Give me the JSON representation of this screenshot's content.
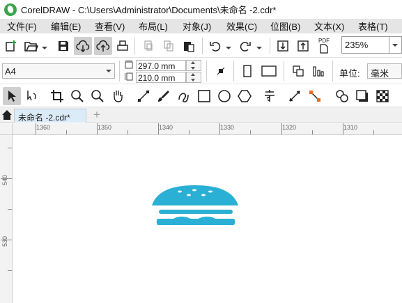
{
  "window": {
    "title": "CorelDRAW - C:\\Users\\Administrator\\Documents\\未命名 -2.cdr*"
  },
  "menu": {
    "items": [
      "文件(F)",
      "编辑(E)",
      "查看(V)",
      "布局(L)",
      "对象(J)",
      "效果(C)",
      "位图(B)",
      "文本(X)",
      "表格(T)"
    ]
  },
  "standard_toolbar": {
    "zoom_value": "235%",
    "pdf_label": "PDF"
  },
  "property_bar": {
    "page_size": "A4",
    "width_value": "297.0 mm",
    "height_value": "210.0 mm",
    "units_label": "单位:",
    "units_value": "毫米"
  },
  "document_tabs": {
    "active_tab": "未命名 -2.cdr*",
    "add_tab_symbol": "+"
  },
  "rulers": {
    "top_labels": [
      "1360",
      "1350",
      "1340",
      "1330",
      "1320",
      "1310"
    ],
    "left_labels": [
      "540",
      "530"
    ]
  },
  "artwork": {
    "name": "burger-icon",
    "color": "#2ab0d4"
  },
  "colors": {
    "menubar_bg": "#e5e5e5",
    "active_tab_bg": "#dcebf8",
    "app_green": "#3aa54a"
  }
}
